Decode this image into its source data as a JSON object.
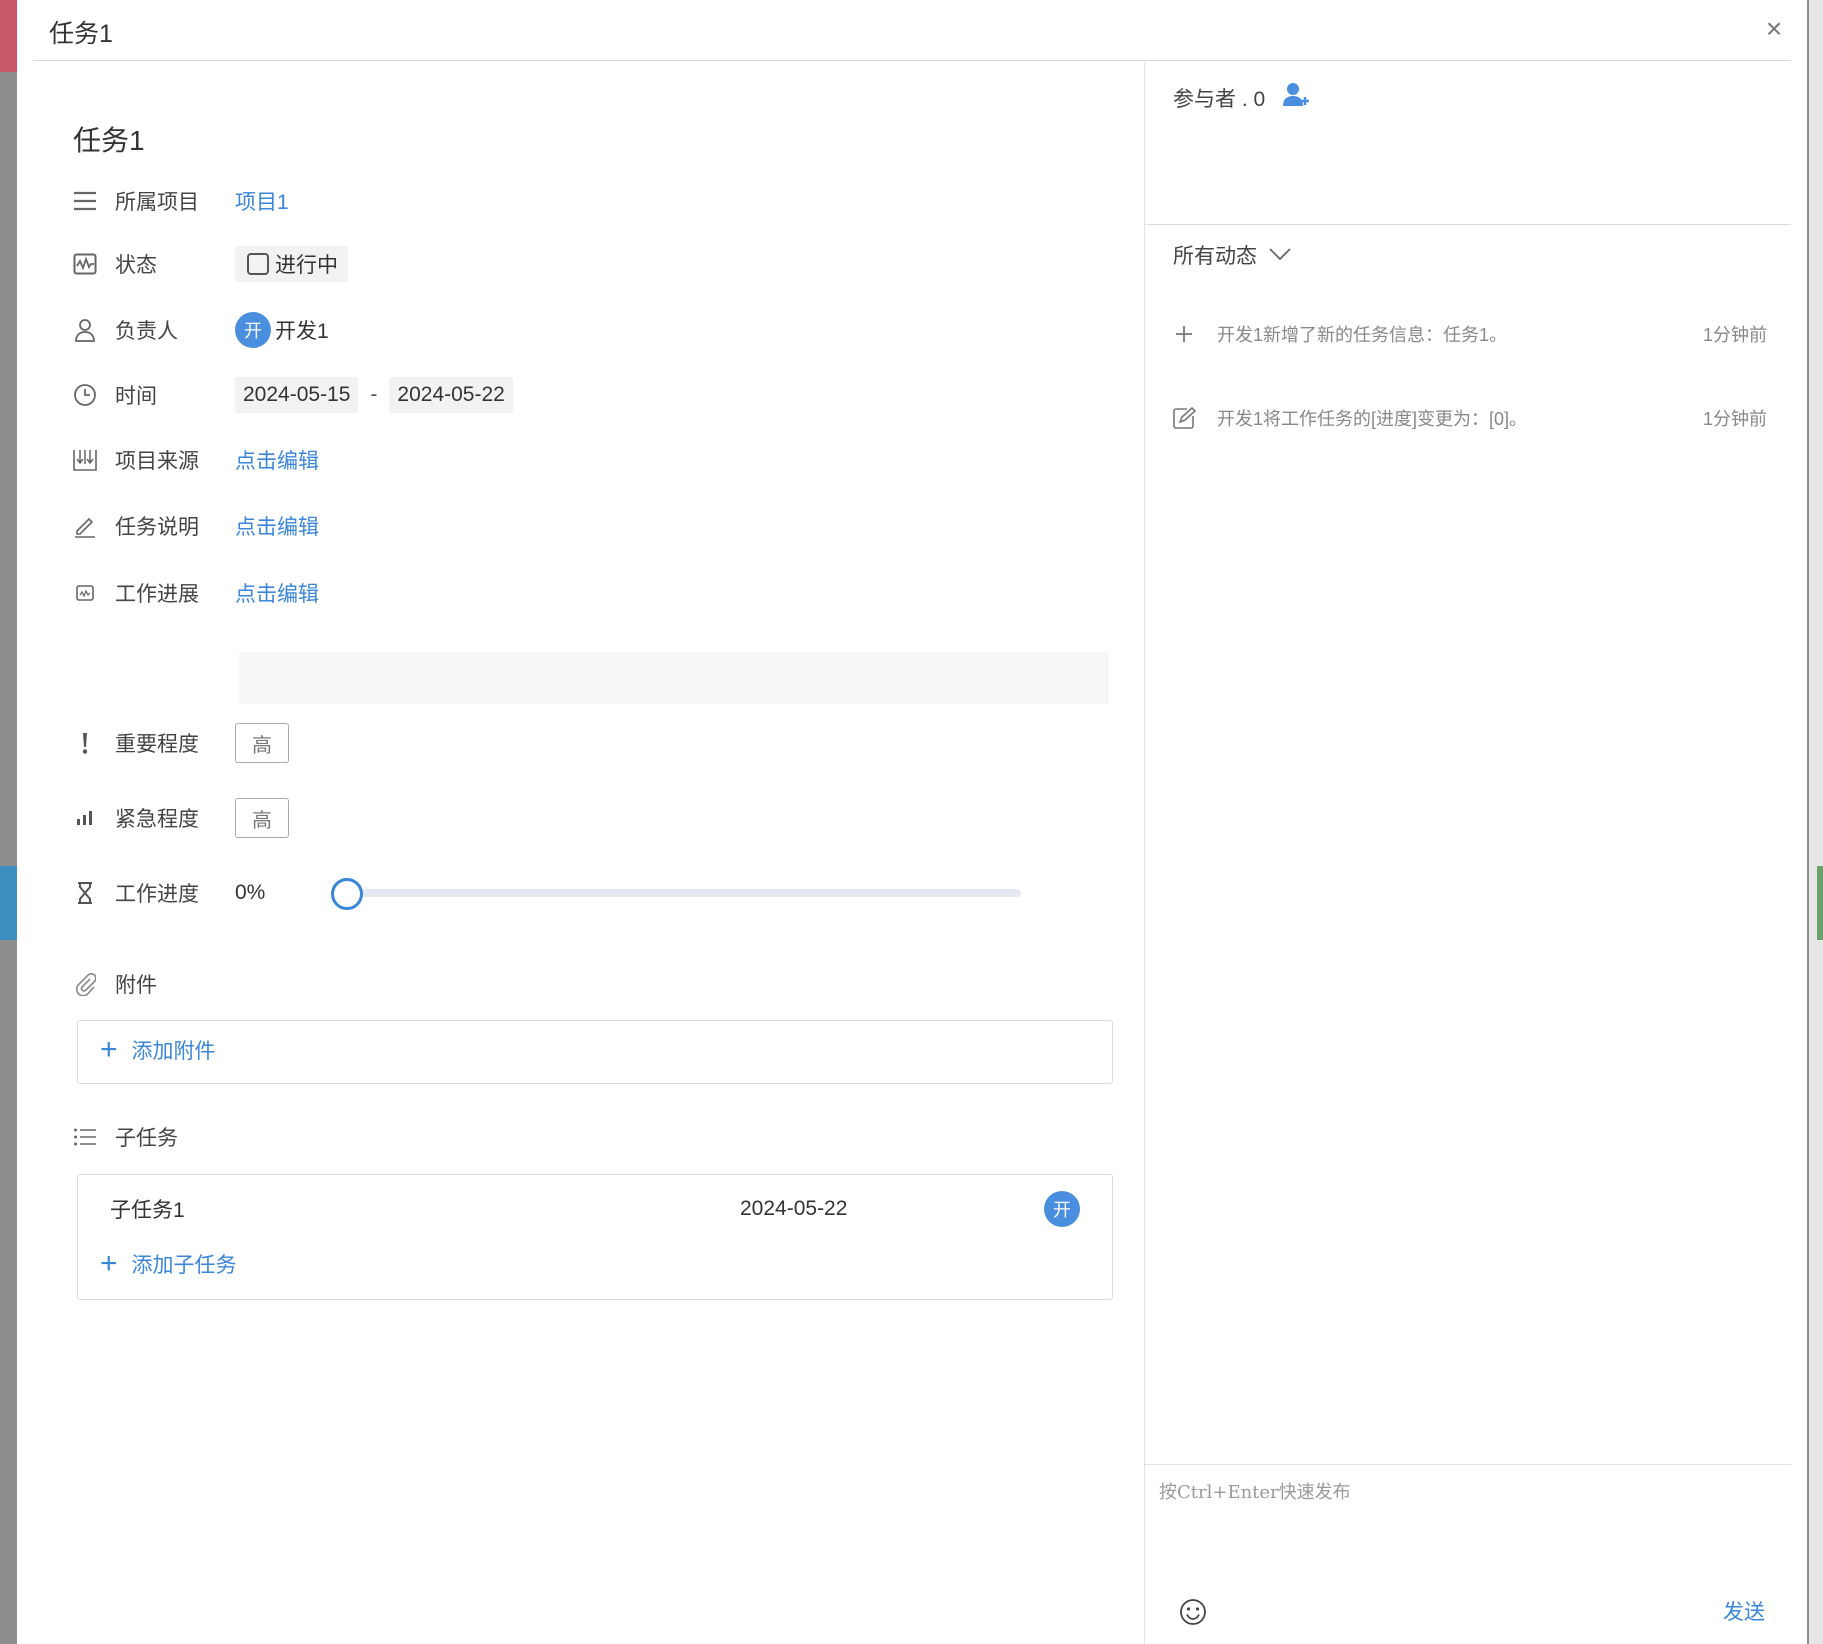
{
  "dialog": {
    "title": "任务1",
    "close_label": "×"
  },
  "task": {
    "name": "任务1",
    "fields": {
      "project": {
        "label": "所属项目",
        "value": "项目1"
      },
      "status": {
        "label": "状态",
        "value": "进行中"
      },
      "owner": {
        "label": "负责人",
        "avatar": "开",
        "name": "开发1"
      },
      "time": {
        "label": "时间",
        "start": "2024-05-15",
        "separator": "-",
        "end": "2024-05-22"
      },
      "source": {
        "label": "项目来源",
        "value": "点击编辑"
      },
      "description": {
        "label": "任务说明",
        "value": "点击编辑"
      },
      "progress_notes": {
        "label": "工作进展",
        "value": "点击编辑"
      },
      "importance": {
        "label": "重要程度",
        "value": "高"
      },
      "urgency": {
        "label": "紧急程度",
        "value": "高"
      },
      "work_progress": {
        "label": "工作进度",
        "value_text": "0%",
        "value": 0
      }
    },
    "attachments": {
      "label": "附件",
      "add_label": "添加附件"
    },
    "subtasks": {
      "label": "子任务",
      "items": [
        {
          "name": "子任务1",
          "date": "2024-05-22",
          "avatar": "开"
        }
      ],
      "add_label": "添加子任务"
    }
  },
  "sidebar": {
    "participants_label": "参与者 . 0",
    "activity_filter": "所有动态",
    "activities": [
      {
        "icon": "plus-icon",
        "text": "开发1新增了新的任务信息：任务1。",
        "time": "1分钟前"
      },
      {
        "icon": "edit-icon",
        "text": "开发1将工作任务的[进度]变更为：[0]。",
        "time": "1分钟前"
      }
    ],
    "composer_placeholder": "按Ctrl+Enter快速发布",
    "send_label": "发送"
  },
  "colors": {
    "accent": "#3a86d8",
    "avatar_bg": "#4a8ee0"
  }
}
